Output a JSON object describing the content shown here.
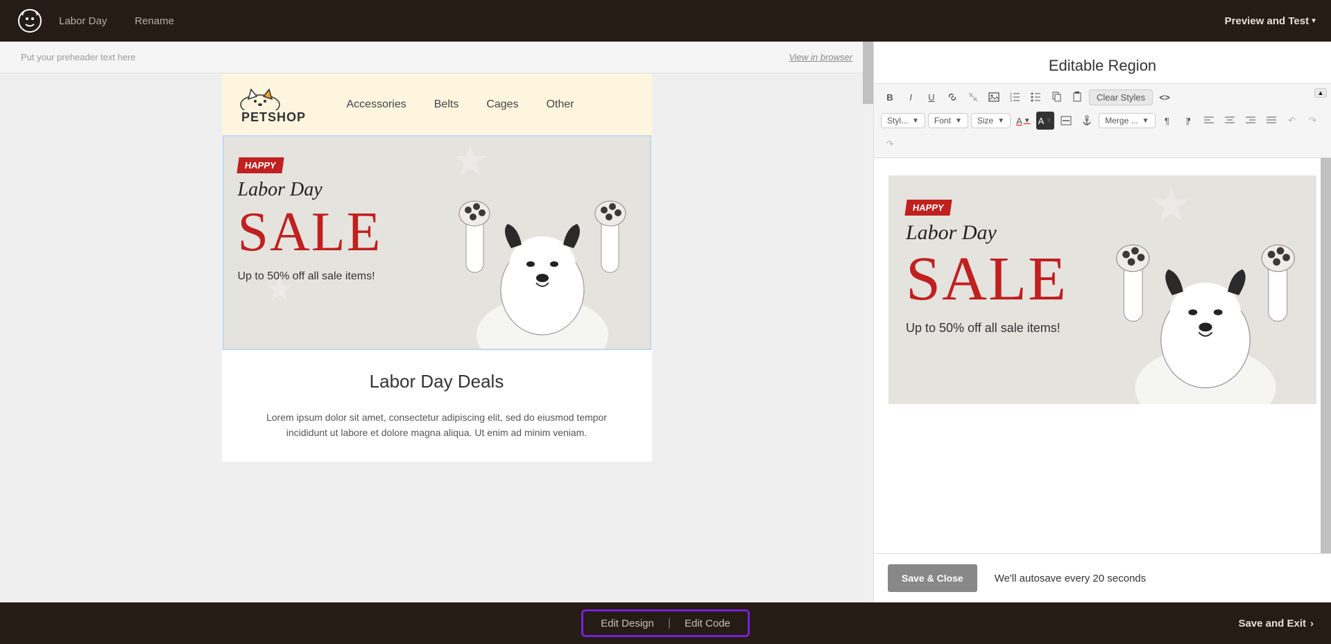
{
  "topBar": {
    "campaignName": "Labor Day",
    "rename": "Rename",
    "previewTest": "Preview and Test"
  },
  "preheader": {
    "placeholder": "Put your preheader text here",
    "viewInBrowser": "View in browser"
  },
  "emailHeader": {
    "logoText": "PETSHOP",
    "nav": [
      "Accessories",
      "Belts",
      "Cages",
      "Other"
    ]
  },
  "hero": {
    "badge": "HAPPY",
    "line1": "Labor Day",
    "sale": "SALE",
    "sub": "Up to 50% off all sale items!"
  },
  "content": {
    "title": "Labor Day Deals",
    "text": "Lorem ipsum dolor sit amet, consectetur adipiscing elit, sed do eiusmod tempor incididunt ut labore et dolore magna aliqua. Ut enim ad minim veniam."
  },
  "rightPanel": {
    "title": "Editable Region",
    "toolbar": {
      "clearStyles": "Clear Styles",
      "styles": "Styl...",
      "font": "Font",
      "size": "Size",
      "merge": "Merge ..."
    },
    "saveClose": "Save & Close",
    "autosave": "We'll autosave every 20 seconds"
  },
  "bottomBar": {
    "editDesign": "Edit Design",
    "editCode": "Edit Code",
    "saveExit": "Save and Exit"
  }
}
